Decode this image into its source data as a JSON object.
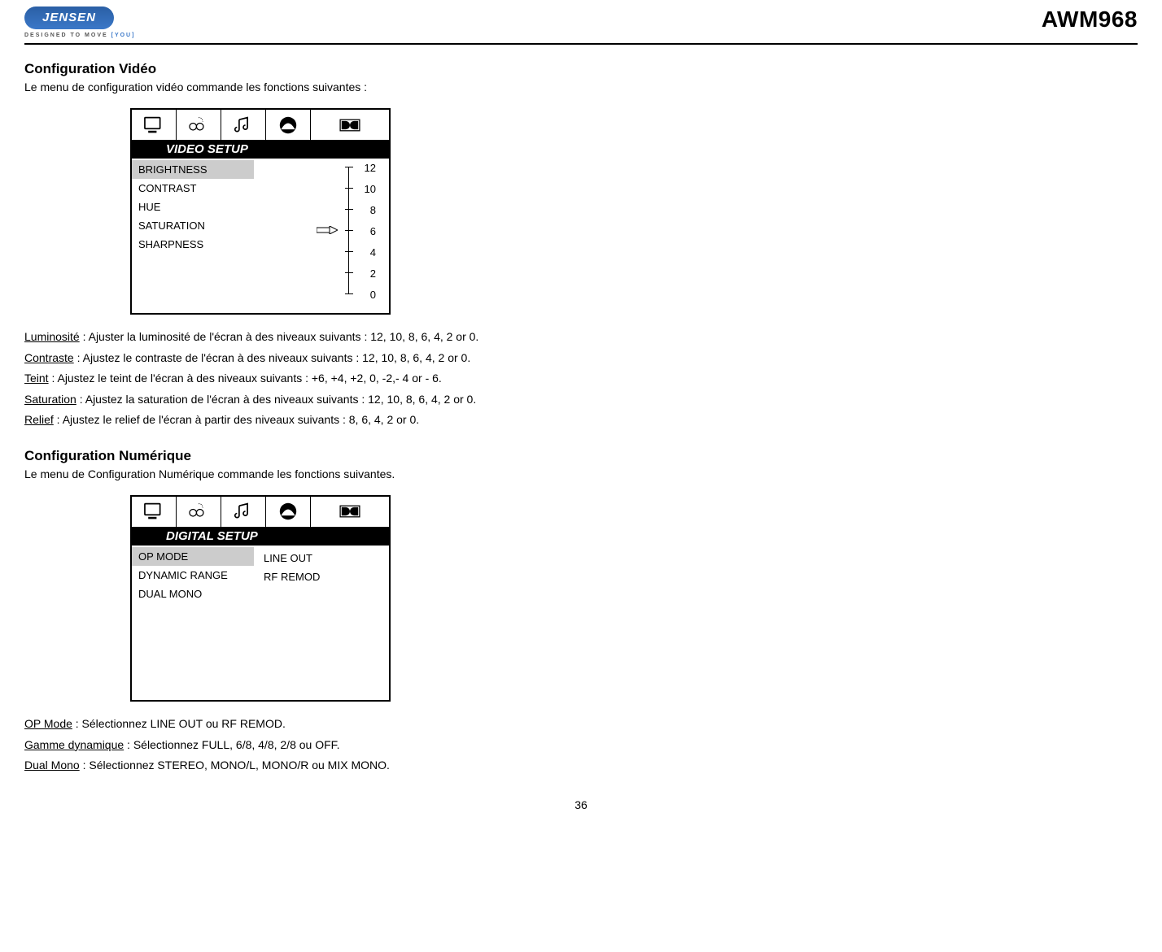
{
  "header": {
    "brand": "JENSEN",
    "tagline_prefix": "DESIGNED TO MOVE ",
    "tagline_you": "[YOU]",
    "model": "AWM968"
  },
  "section1": {
    "title": "Configuration Vidéo",
    "intro": "Le menu de configuration vidéo commande les fonctions suivantes :"
  },
  "video_setup": {
    "panel_title": "VIDEO SETUP",
    "items": [
      "BRIGHTNESS",
      "CONTRAST",
      "HUE",
      "SATURATION",
      "SHARPNESS"
    ],
    "selected_index": 0,
    "scale_values": [
      "12",
      "10",
      "8",
      "6",
      "4",
      "2",
      "0"
    ],
    "pointer_at_index": 3
  },
  "video_desc": [
    {
      "term": "Luminosité",
      "rest": " : Ajuster la luminosité de l'écran à des niveaux suivants : 12, 10, 8, 6, 4, 2 or 0."
    },
    {
      "term": "Contraste",
      "rest": " : Ajustez le contraste de l'écran à des niveaux suivants : 12, 10, 8, 6, 4, 2 or 0."
    },
    {
      "term": "Teint",
      "rest": " : Ajustez le teint de l'écran à des niveaux suivants : +6, +4, +2, 0, -2,- 4 or - 6."
    },
    {
      "term": "Saturation",
      "rest": " : Ajustez la saturation de l'écran à des niveaux suivants : 12, 10, 8, 6, 4, 2 or 0."
    },
    {
      "term": "Relief",
      "rest": " : Ajustez le relief de l'écran à partir des niveaux suivants : 8, 6, 4, 2 or 0."
    }
  ],
  "section2": {
    "title": "Configuration Numérique",
    "intro": "Le menu de Configuration Numérique commande les fonctions suivantes."
  },
  "digital_setup": {
    "panel_title": "DIGITAL SETUP",
    "left_items": [
      "OP MODE",
      "DYNAMIC RANGE",
      "DUAL MONO"
    ],
    "selected_index": 0,
    "right_items": [
      "LINE OUT",
      "RF REMOD"
    ]
  },
  "digital_desc": [
    {
      "term": "OP Mode",
      "rest": " : Sélectionnez LINE OUT ou RF REMOD."
    },
    {
      "term": "Gamme dynamique",
      "rest": " : Sélectionnez FULL, 6/8, 4/8, 2/8 ou OFF."
    },
    {
      "term": "Dual Mono",
      "rest": " : Sélectionnez STEREO, MONO/L, MONO/R ou MIX MONO."
    }
  ],
  "page_number": "36"
}
